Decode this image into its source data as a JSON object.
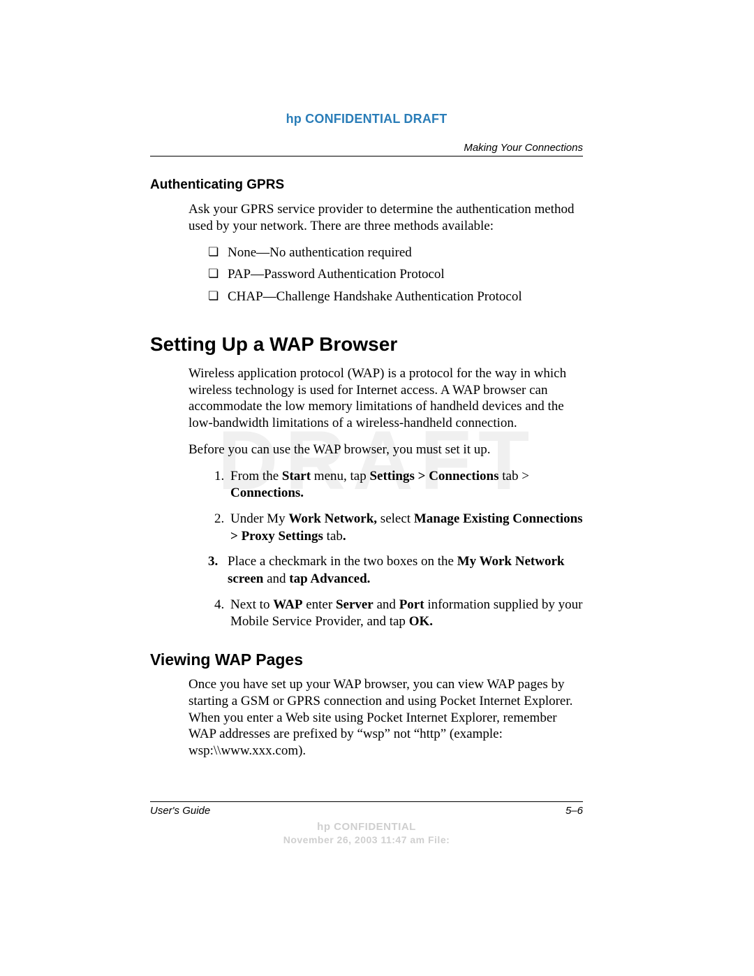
{
  "header": {
    "confidential": "hp CONFIDENTIAL DRAFT",
    "chapter": "Making Your Connections"
  },
  "watermark": "DRAFT",
  "sections": {
    "auth_gprs": {
      "title": "Authenticating GPRS",
      "intro": "Ask your GPRS service provider to determine the authentication method used by your network. There are three methods available:",
      "items": [
        "None—No authentication required",
        "PAP—Password Authentication Protocol",
        "CHAP—Challenge Handshake Authentication Protocol"
      ]
    },
    "wap_setup": {
      "title": "Setting Up a WAP Browser",
      "p1": "Wireless application protocol (WAP) is a protocol for the way in which wireless technology is used for Internet access. A WAP browser can accommodate the low memory limitations of handheld devices and the low-bandwidth limitations of a wireless-handheld connection.",
      "p2": "Before you can use the WAP browser, you must set it up.",
      "steps": {
        "s1": {
          "a": "From the ",
          "b": "Start",
          "c": " menu, tap ",
          "d": "Settings > Connections",
          "e": " tab > ",
          "f": "Connections."
        },
        "s2": {
          "a": "Under My ",
          "b": "Work Network,",
          "c": " select ",
          "d": "Manage Existing Connections > Proxy Settings",
          "e": " tab",
          "f": "."
        },
        "s3": {
          "num": "3.",
          "a": "Place a checkmark in the two boxes on the ",
          "b": "My Work Network screen",
          "c": " and ",
          "d": "tap Advanced."
        },
        "s4": {
          "a": "Next to ",
          "b": "WAP",
          "c": " enter ",
          "d": "Server",
          "e": " and ",
          "f": "Port",
          "g": " information supplied by your Mobile Service Provider, and tap ",
          "h": "OK."
        }
      }
    },
    "viewing": {
      "title": "Viewing WAP Pages",
      "p": "Once you have set up your WAP browser, you can view WAP pages by starting a GSM or GPRS connection and using Pocket Internet Explorer. When you enter a Web site using Pocket Internet Explorer, remember WAP addresses are prefixed by “wsp” not “http” (example: wsp:\\\\www.xxx.com)."
    }
  },
  "footer": {
    "left": "User's Guide",
    "right": "5–6",
    "conf": "hp CONFIDENTIAL",
    "date": "November 26, 2003 11:47 am File:"
  }
}
